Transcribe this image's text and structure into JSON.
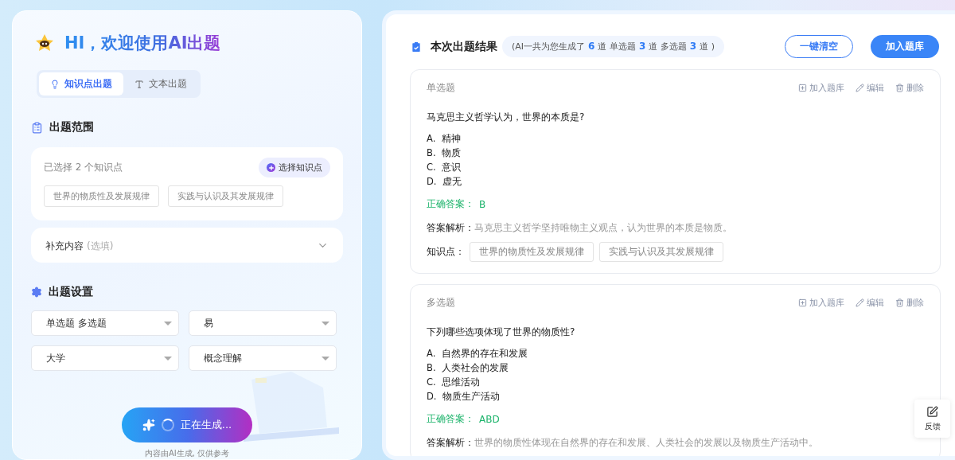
{
  "left": {
    "title": "HI，欢迎使用AI出题",
    "tabs": [
      {
        "label": "知识点出题",
        "selected": true
      },
      {
        "label": "文本出题",
        "selected": false
      }
    ],
    "scope": {
      "heading": "出题范围",
      "selected_count": "已选择 2 个知识点",
      "pick_button": "选择知识点",
      "tags": [
        "世界的物质性及发展规律",
        "实践与认识及其发展规律"
      ]
    },
    "supplement": {
      "label": "补充内容",
      "hint": "(选填)",
      "expanded": false
    },
    "settings": {
      "heading": "出题设置",
      "selects": [
        "单选题 多选题",
        "易",
        "大学",
        "概念理解"
      ]
    },
    "generate": {
      "label": "正在生成...",
      "loading": true
    },
    "note": "内容由AI生成, 仅供参考"
  },
  "right": {
    "heading": "本次出题结果",
    "summary": [
      {
        "kind": "text",
        "text": "(AI一共为您生成了"
      },
      {
        "kind": "count",
        "text": "6"
      },
      {
        "kind": "text",
        "text": "道 单选题"
      },
      {
        "kind": "count",
        "text": "3"
      },
      {
        "kind": "text",
        "text": "道 多选题"
      },
      {
        "kind": "count",
        "text": "3"
      },
      {
        "kind": "text",
        "text": "道 )"
      }
    ],
    "clear_button": "一键清空",
    "add_button": "加入题库",
    "questions": [
      {
        "type": "单选题",
        "actions": [
          "加入题库",
          "编辑",
          "删除"
        ],
        "stem": "马克思主义哲学认为，世界的本质是?",
        "options": [
          {
            "letter": "A.",
            "text": "精神"
          },
          {
            "letter": "B.",
            "text": "物质"
          },
          {
            "letter": "C.",
            "text": "意识"
          },
          {
            "letter": "D.",
            "text": "虚无"
          }
        ],
        "answer_label": "正确答案：",
        "answer": "B",
        "explain_label": "答案解析：",
        "explain": "马克思主义哲学坚持唯物主义观点，认为世界的本质是物质。",
        "knowledge_label": "知识点：",
        "knowledge": [
          "世界的物质性及发展规律",
          "实践与认识及其发展规律"
        ]
      },
      {
        "type": "多选题",
        "actions": [
          "加入题库",
          "编辑",
          "删除"
        ],
        "stem": "下列哪些选项体现了世界的物质性?",
        "options": [
          {
            "letter": "A.",
            "text": "自然界的存在和发展"
          },
          {
            "letter": "B.",
            "text": "人类社会的发展"
          },
          {
            "letter": "C.",
            "text": "思维活动"
          },
          {
            "letter": "D.",
            "text": "物质生产活动"
          }
        ],
        "answer_label": "正确答案：",
        "answer": "ABD",
        "explain_label": "答案解析：",
        "explain": "世界的物质性体现在自然界的存在和发展、人类社会的发展以及物质生产活动中。"
      }
    ]
  },
  "feedback": "反馈"
}
